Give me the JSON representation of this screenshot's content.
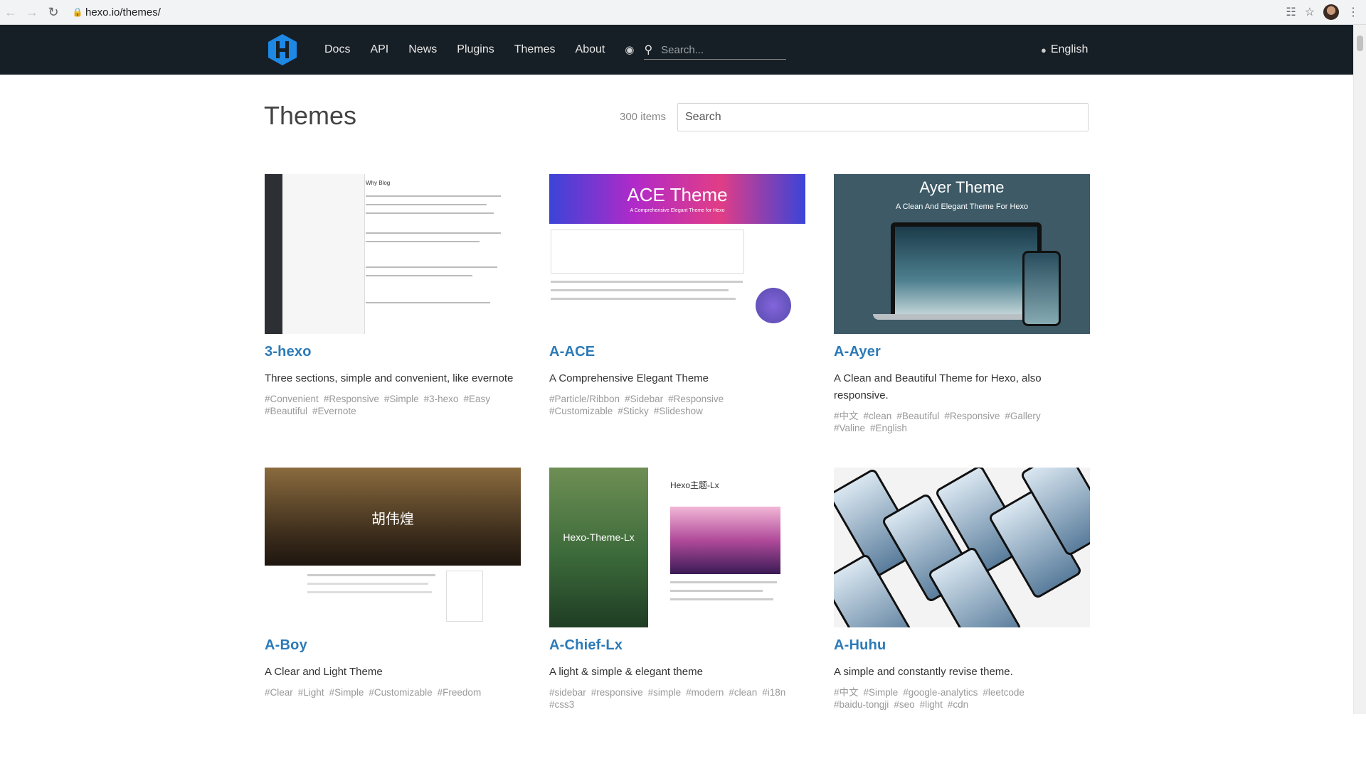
{
  "browser": {
    "url": "hexo.io/themes/"
  },
  "header": {
    "nav": [
      "Docs",
      "API",
      "News",
      "Plugins",
      "Themes",
      "About"
    ],
    "search_placeholder": "Search...",
    "language": "English"
  },
  "page": {
    "title": "Themes",
    "item_count": "300 items",
    "search_placeholder": "Search"
  },
  "themes": [
    {
      "name": "3-hexo",
      "description": "Three sections, simple and convenient, like evernote",
      "tags": [
        "#Convenient",
        "#Responsive",
        "#Simple",
        "#3-hexo",
        "#Easy",
        "#Beautiful",
        "#Evernote"
      ],
      "thumb_text": "Why Blog"
    },
    {
      "name": "A-ACE",
      "description": "A Comprehensive Elegant Theme",
      "tags": [
        "#Particle/Ribbon",
        "#Sidebar",
        "#Responsive",
        "#Customizable",
        "#Sticky",
        "#Slideshow"
      ],
      "thumb_text": "ACE Theme",
      "thumb_sub": "A Comprehensive Elegant Theme for Hexo"
    },
    {
      "name": "A-Ayer",
      "description": "A Clean and Beautiful Theme for Hexo, also responsive.",
      "tags": [
        "#中文",
        "#clean",
        "#Beautiful",
        "#Responsive",
        "#Gallery",
        "#Valine",
        "#English"
      ],
      "thumb_text": "Ayer Theme",
      "thumb_sub": "A Clean And Elegant Theme For Hexo"
    },
    {
      "name": "A-Boy",
      "description": "A Clear and Light Theme",
      "tags": [
        "#Clear",
        "#Light",
        "#Simple",
        "#Customizable",
        "#Freedom"
      ],
      "thumb_text": "胡伟煌"
    },
    {
      "name": "A-Chief-Lx",
      "description": "A light & simple & elegant theme",
      "tags": [
        "#sidebar",
        "#responsive",
        "#simple",
        "#modern",
        "#clean",
        "#i18n",
        "#css3"
      ],
      "thumb_text": "Hexo-Theme-Lx",
      "thumb_sub": "Hexo主题-Lx"
    },
    {
      "name": "A-Huhu",
      "description": "A simple and constantly revise theme.",
      "tags": [
        "#中文",
        "#Simple",
        "#google-analytics",
        "#leetcode",
        "#baidu-tongji",
        "#seo",
        "#light",
        "#cdn"
      ]
    }
  ]
}
